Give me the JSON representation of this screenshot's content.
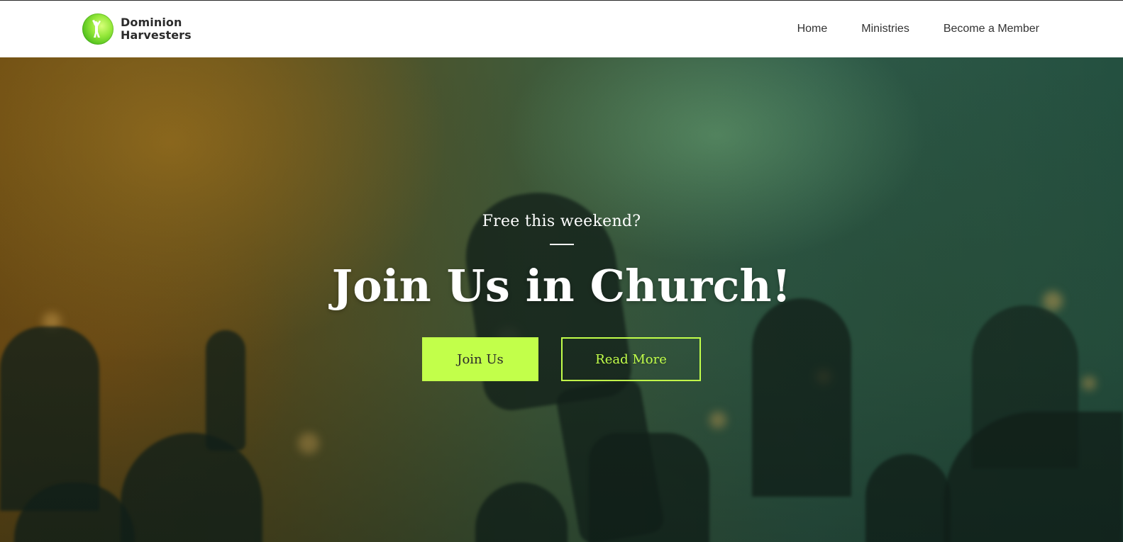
{
  "header": {
    "brand": {
      "line1": "Dominion",
      "line2": "Harvesters",
      "logo_icon": "church-logo-icon"
    },
    "nav": [
      {
        "label": "Home"
      },
      {
        "label": "Ministries"
      },
      {
        "label": "Become a Member"
      }
    ]
  },
  "hero": {
    "eyebrow": "Free this weekend?",
    "title": "Join Us in Church!",
    "buttons": {
      "primary_label": "Join Us",
      "secondary_label": "Read More"
    },
    "background": "worship-crowd-photo"
  },
  "colors": {
    "accent": "#c2ff4a",
    "logo_green": "#6ccf2a",
    "header_bg": "#ffffff",
    "text_dark": "#2b2b2b"
  }
}
